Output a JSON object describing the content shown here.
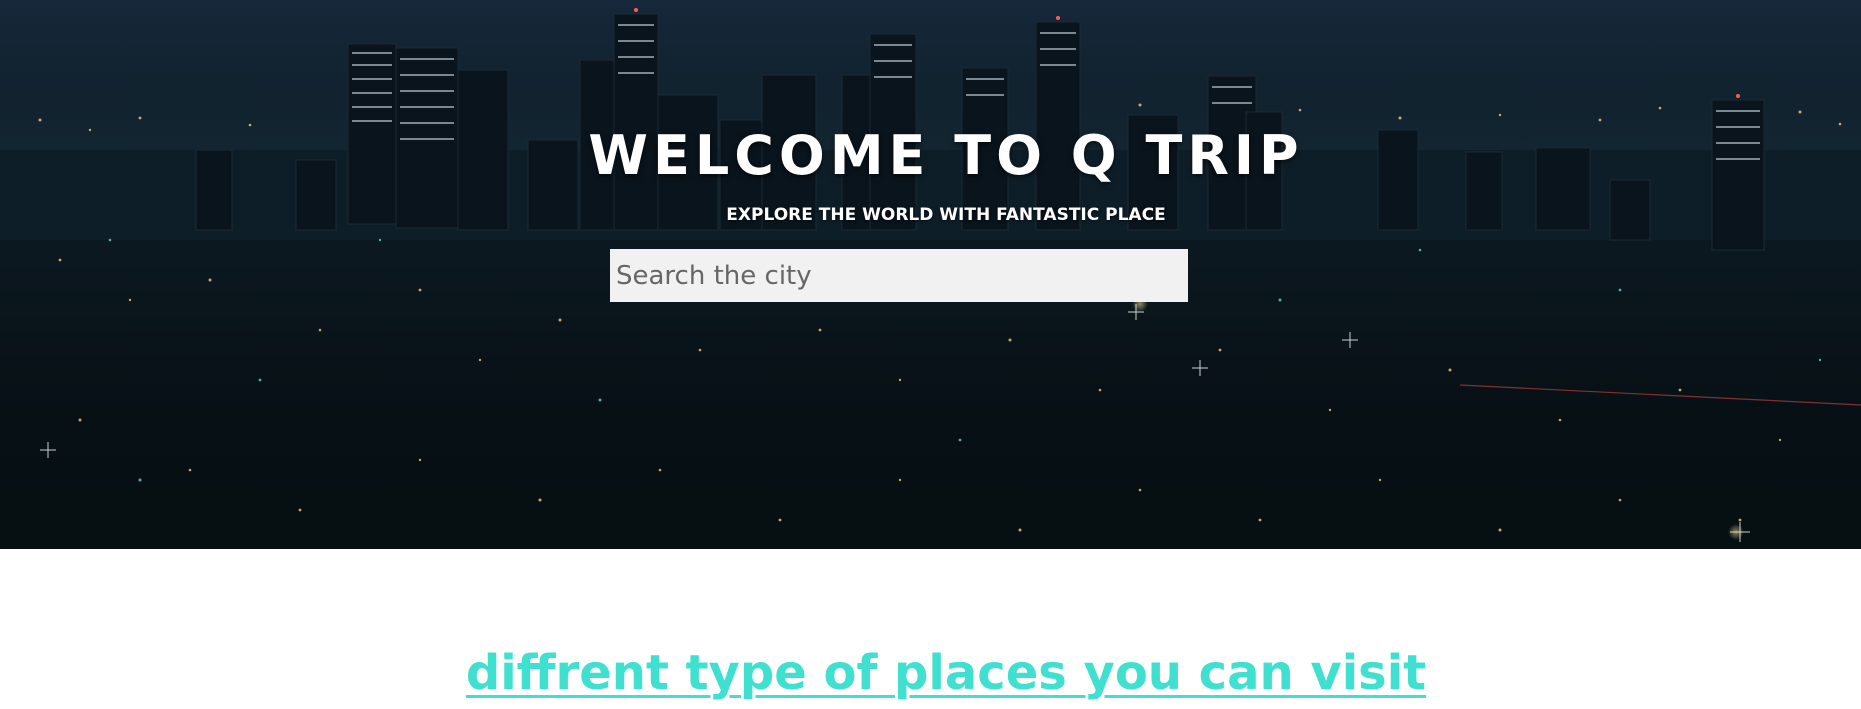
{
  "hero": {
    "title": "WELCOME TO Q TRIP",
    "subtitle": "EXPLORE THE WORLD WITH FANTASTIC PLACE",
    "background": "night-city-skyline-image"
  },
  "search": {
    "placeholder": "Search the city",
    "value": ""
  },
  "section": {
    "heading": "diffrent type of places you can visit"
  },
  "colors": {
    "heading_accent": "#40e0d0",
    "search_bg": "#f1f1f1",
    "hero_text": "#ffffff"
  }
}
